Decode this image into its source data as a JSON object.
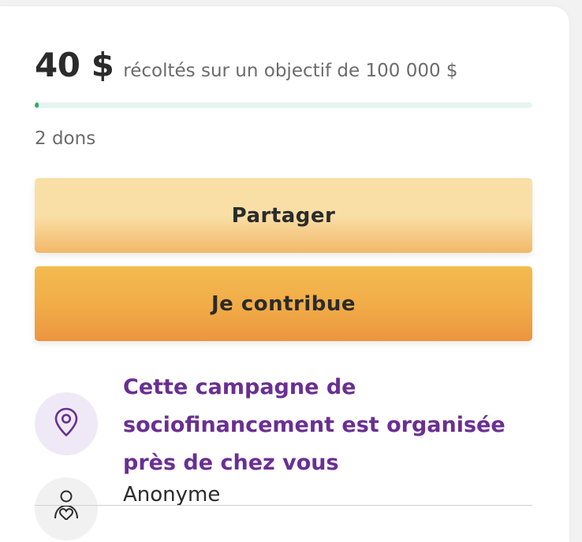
{
  "campaign": {
    "amount_raised": "40 $",
    "goal_text": "récoltés sur un objectif de 100 000 $",
    "progress_fraction": 0.0004,
    "donations_count": "2 dons"
  },
  "actions": {
    "share_label": "Partager",
    "contribute_label": "Je contribue"
  },
  "location_notice": {
    "icon": "location-pin-icon",
    "text": "Cette campagne de sociofinancement est organisée près de chez vous"
  },
  "organizer": {
    "icon": "person-heart-icon",
    "name": "Anonyme"
  },
  "colors": {
    "progress_fill": "#2eae62",
    "progress_track": "#e6f4ee",
    "share_button": "#f9dfa6",
    "contribute_button": "#f1ab47",
    "accent_purple": "#6a2f92",
    "icon_bg_purple": "#efe9f7"
  }
}
